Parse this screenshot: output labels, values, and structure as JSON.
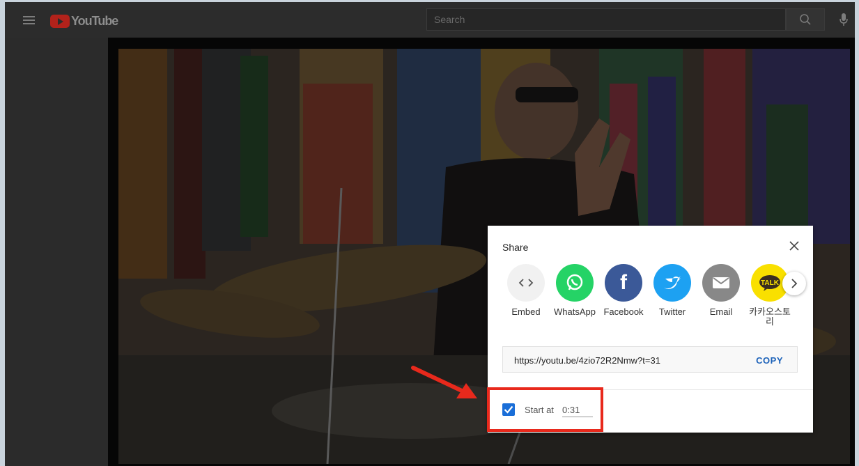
{
  "header": {
    "logo_text": "YouTube",
    "search_placeholder": "Search"
  },
  "share": {
    "title": "Share",
    "items": [
      {
        "label": "Embed",
        "icon": "embed-icon",
        "color": "#f2f2f2"
      },
      {
        "label": "WhatsApp",
        "icon": "whatsapp-icon",
        "color": "#25d366"
      },
      {
        "label": "Facebook",
        "icon": "facebook-icon",
        "color": "#3b5998"
      },
      {
        "label": "Twitter",
        "icon": "twitter-icon",
        "color": "#1da1f2"
      },
      {
        "label": "Email",
        "icon": "email-icon",
        "color": "#888888"
      },
      {
        "label": "카카오스토리",
        "icon": "kakao-talk-icon",
        "color": "#f9e000"
      }
    ],
    "link": "https://youtu.be/4zio72R2Nmw?t=31",
    "copy_label": "COPY",
    "start_at_label": "Start at",
    "start_at_value": "0:31",
    "start_at_checked": true
  },
  "colors": {
    "accent": "#1a6ed8",
    "highlight": "#e8291c",
    "copy": "#1c62b9"
  }
}
